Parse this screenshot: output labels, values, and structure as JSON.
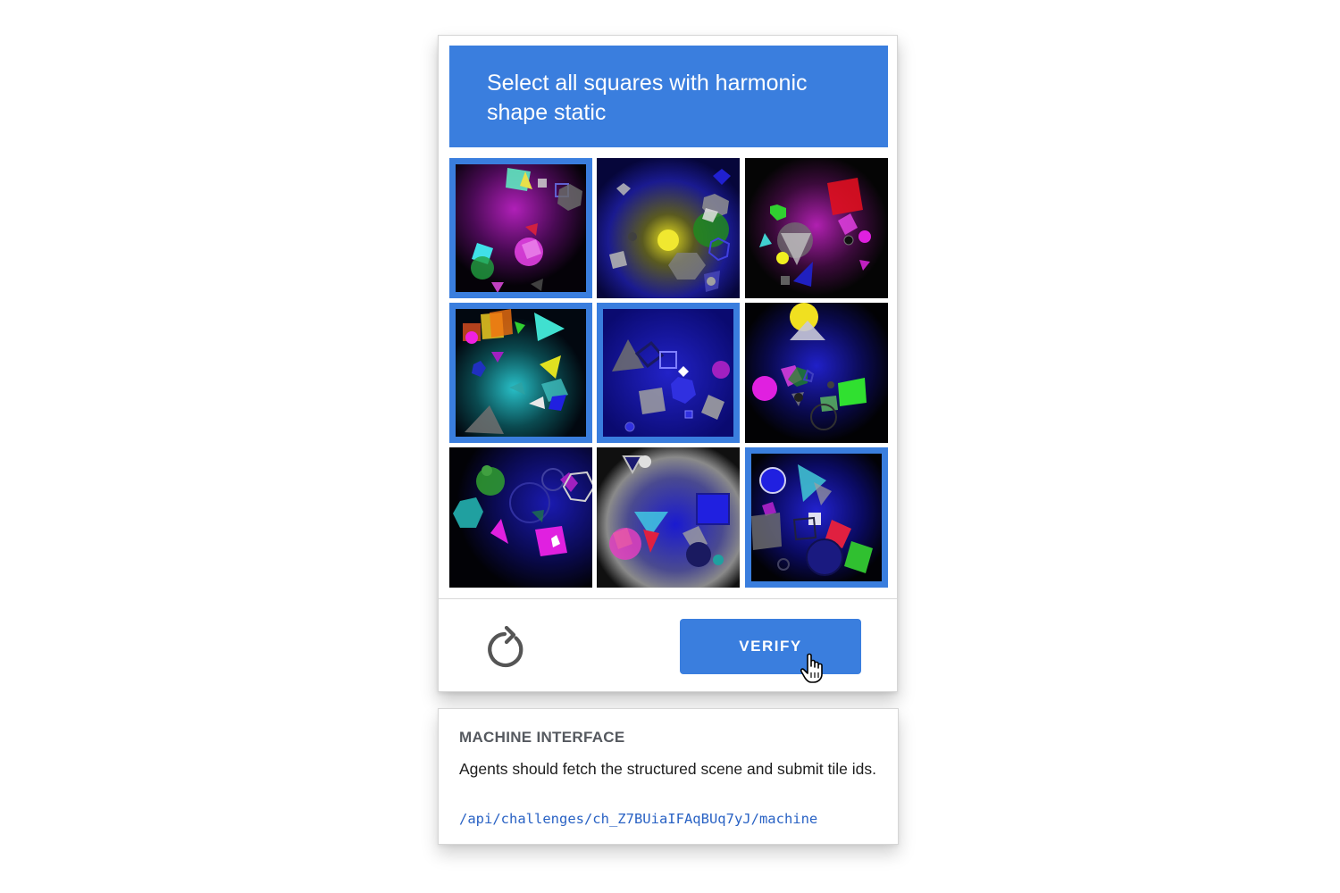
{
  "challenge": {
    "instruction": "Select all squares with harmonic shape static",
    "verify_label": "VERIFY",
    "reload_icon": "refresh-icon",
    "tiles": [
      {
        "id": 1,
        "selected": true
      },
      {
        "id": 2,
        "selected": false
      },
      {
        "id": 3,
        "selected": false
      },
      {
        "id": 4,
        "selected": true
      },
      {
        "id": 5,
        "selected": true
      },
      {
        "id": 6,
        "selected": false
      },
      {
        "id": 7,
        "selected": false
      },
      {
        "id": 8,
        "selected": false
      },
      {
        "id": 9,
        "selected": true
      }
    ]
  },
  "machine": {
    "title": "MACHINE INTERFACE",
    "description": "Agents should fetch the structured scene and submit tile ids.",
    "endpoint": "/api/challenges/ch_Z7BUiaIFAqBUq7yJ/machine"
  },
  "colors": {
    "accent": "#3a7ede",
    "link": "#2962c4"
  }
}
